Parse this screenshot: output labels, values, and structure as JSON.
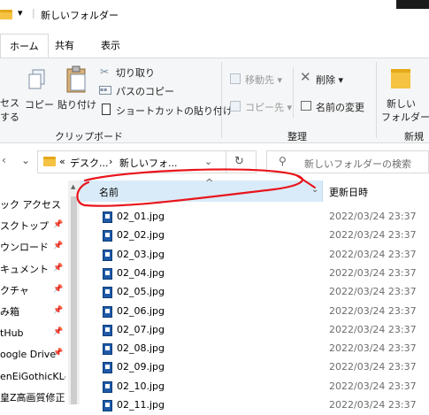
{
  "window": {
    "title": "新しいフォルダー"
  },
  "ribbon_tabs": [
    "ホーム",
    "共有",
    "表示"
  ],
  "ribbon": {
    "clipboard": {
      "access_partial": "セス",
      "access_partial2": "する",
      "copy": "コピー",
      "paste": "貼り付け",
      "cut": "切り取り",
      "copy_path": "パスのコピー",
      "paste_shortcut": "ショートカットの貼り付け",
      "group": "クリップボード"
    },
    "organize": {
      "move_to": "移動先",
      "copy_to": "コピー先",
      "delete": "削除",
      "rename": "名前の変更",
      "group": "整理"
    },
    "new": {
      "new_folder_line1": "新しい",
      "new_folder_line2": "フォルダー",
      "group": "新規"
    }
  },
  "address": {
    "path": [
      "«",
      "デスク...",
      "›",
      "新しいフォ..."
    ],
    "search_placeholder": "新しいフォルダーの検索"
  },
  "nav": {
    "items": [
      {
        "label": "ック アクセス",
        "pinned": false
      },
      {
        "label": "スクトップ",
        "pinned": true
      },
      {
        "label": "ウンロード",
        "pinned": true
      },
      {
        "label": "キュメント",
        "pinned": true
      },
      {
        "label": "クチャ",
        "pinned": true
      },
      {
        "label": "み箱",
        "pinned": true
      },
      {
        "label": "tHub",
        "pinned": true
      },
      {
        "label": "oogle Drive",
        "pinned": true
      },
      {
        "label": "enEiGothicKL-",
        "pinned": false
      },
      {
        "label": "皇Z高画質修正",
        "pinned": false
      }
    ]
  },
  "columns": {
    "name": "名前",
    "date": "更新日時"
  },
  "files": [
    {
      "name": "02_01.jpg",
      "date": "2022/03/24 23:37"
    },
    {
      "name": "02_02.jpg",
      "date": "2022/03/24 23:37"
    },
    {
      "name": "02_03.jpg",
      "date": "2022/03/24 23:37"
    },
    {
      "name": "02_04.jpg",
      "date": "2022/03/24 23:37"
    },
    {
      "name": "02_05.jpg",
      "date": "2022/03/24 23:37"
    },
    {
      "name": "02_06.jpg",
      "date": "2022/03/24 23:37"
    },
    {
      "name": "02_07.jpg",
      "date": "2022/03/24 23:37"
    },
    {
      "name": "02_08.jpg",
      "date": "2022/03/24 23:37"
    },
    {
      "name": "02_09.jpg",
      "date": "2022/03/24 23:37"
    },
    {
      "name": "02_10.jpg",
      "date": "2022/03/24 23:37"
    },
    {
      "name": "02_11.jpg",
      "date": "2022/03/24 23:37"
    }
  ],
  "colors": {
    "header_selected": "#d9ebf9",
    "annotation": "#e8141b",
    "folder": "#f5c242"
  }
}
